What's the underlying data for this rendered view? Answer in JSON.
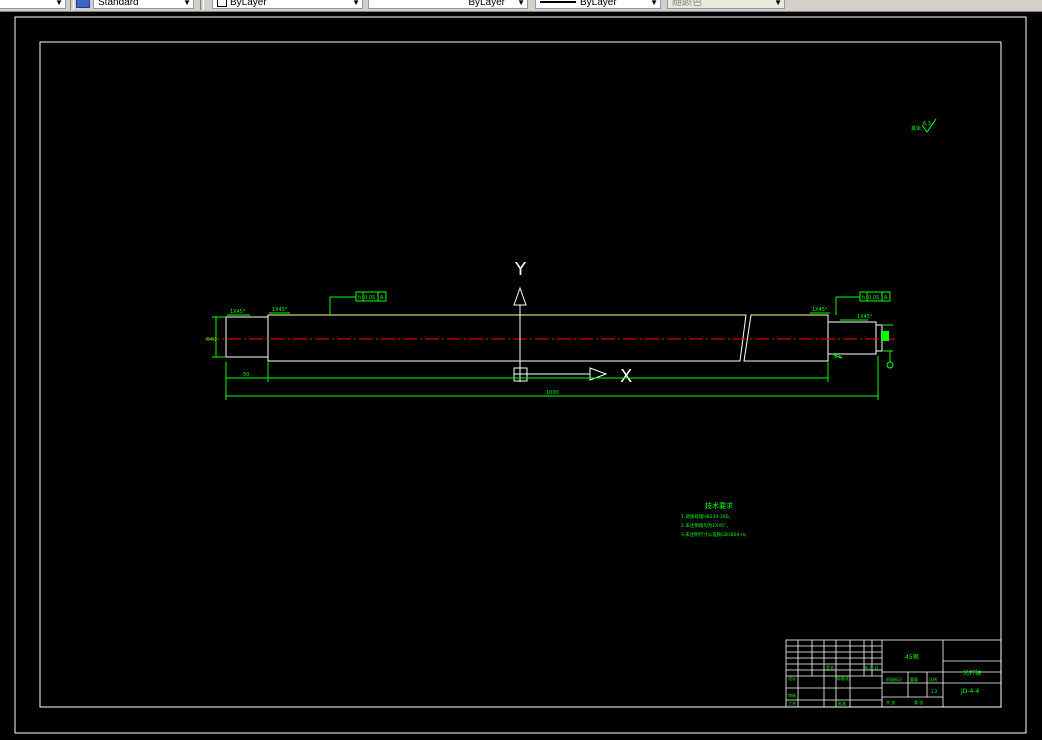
{
  "toolbar": {
    "text_style": "Standard",
    "layer": "ByLayer",
    "linetype": "ByLayer",
    "lineweight": "ByLayer",
    "plot_style": "随颜色"
  },
  "drawing": {
    "axis_y_label": "Y",
    "axis_x_label": "X",
    "chamfer_left_1": "1X45°",
    "chamfer_left_2": "1X45°",
    "chamfer_right_1": "1X45°",
    "chamfer_right_2": "1X45°",
    "roughness_label": "其余",
    "roughness_value": "6.3",
    "tolerance_h": "h",
    "tolerance_value": "0.05",
    "tolerance_datum": "A",
    "dim_left_height": "Φ40",
    "dim_left_short": "50",
    "dim_overall": "1000",
    "dim_right_small": "1.5",
    "notes_title": "技术要求",
    "notes": [
      "1.调质处理HB230-260。",
      "2.未注倒角均为1X45°。",
      "3.未注明尺寸公差按GB1804-m。"
    ]
  },
  "title_block": {
    "material": "45钢",
    "part_name": "光杆轴",
    "drawing_number": "JD-4-4",
    "scale": "1:2",
    "signature_label": "签名",
    "date_label": "年.月.日",
    "design_label": "设计",
    "check_label": "审核",
    "process_label": "工艺",
    "standard_label": "标准化",
    "approve_label": "批准",
    "mark_label": "阶段标记",
    "weight_label": "重量",
    "scale_label": "比例",
    "sheet_total": "共 张",
    "sheet_num": "第 张"
  },
  "colors": {
    "frame": "#ffffe0",
    "annotation": "#00ff00",
    "outline": "#ffffff",
    "centerline": "#ff0000"
  }
}
